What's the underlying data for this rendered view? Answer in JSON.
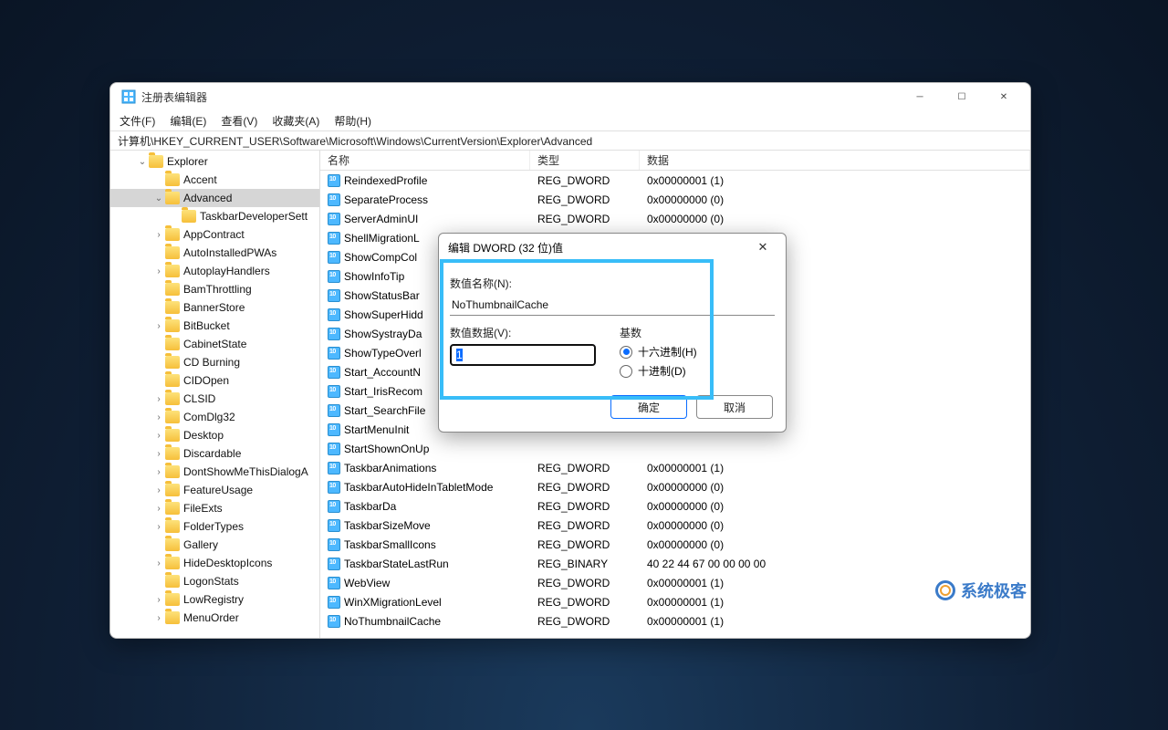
{
  "window": {
    "title": "注册表编辑器",
    "menu": [
      "文件(F)",
      "编辑(E)",
      "查看(V)",
      "收藏夹(A)",
      "帮助(H)"
    ],
    "address": "计算机\\HKEY_CURRENT_USER\\Software\\Microsoft\\Windows\\CurrentVersion\\Explorer\\Advanced"
  },
  "tree": [
    {
      "indent": 1,
      "chev": "∨",
      "label": "Explorer"
    },
    {
      "indent": 2,
      "chev": "",
      "label": "Accent"
    },
    {
      "indent": 2,
      "chev": "∨",
      "label": "Advanced",
      "selected": true
    },
    {
      "indent": 3,
      "chev": "",
      "label": "TaskbarDeveloperSett"
    },
    {
      "indent": 2,
      "chev": ">",
      "label": "AppContract"
    },
    {
      "indent": 2,
      "chev": "",
      "label": "AutoInstalledPWAs"
    },
    {
      "indent": 2,
      "chev": ">",
      "label": "AutoplayHandlers"
    },
    {
      "indent": 2,
      "chev": "",
      "label": "BamThrottling"
    },
    {
      "indent": 2,
      "chev": "",
      "label": "BannerStore"
    },
    {
      "indent": 2,
      "chev": ">",
      "label": "BitBucket"
    },
    {
      "indent": 2,
      "chev": "",
      "label": "CabinetState"
    },
    {
      "indent": 2,
      "chev": "",
      "label": "CD Burning"
    },
    {
      "indent": 2,
      "chev": "",
      "label": "CIDOpen"
    },
    {
      "indent": 2,
      "chev": ">",
      "label": "CLSID"
    },
    {
      "indent": 2,
      "chev": ">",
      "label": "ComDlg32"
    },
    {
      "indent": 2,
      "chev": ">",
      "label": "Desktop"
    },
    {
      "indent": 2,
      "chev": ">",
      "label": "Discardable"
    },
    {
      "indent": 2,
      "chev": ">",
      "label": "DontShowMeThisDialogA"
    },
    {
      "indent": 2,
      "chev": ">",
      "label": "FeatureUsage"
    },
    {
      "indent": 2,
      "chev": ">",
      "label": "FileExts"
    },
    {
      "indent": 2,
      "chev": ">",
      "label": "FolderTypes"
    },
    {
      "indent": 2,
      "chev": "",
      "label": "Gallery"
    },
    {
      "indent": 2,
      "chev": ">",
      "label": "HideDesktopIcons"
    },
    {
      "indent": 2,
      "chev": "",
      "label": "LogonStats"
    },
    {
      "indent": 2,
      "chev": ">",
      "label": "LowRegistry"
    },
    {
      "indent": 2,
      "chev": ">",
      "label": "MenuOrder"
    }
  ],
  "list": {
    "columns": [
      "名称",
      "类型",
      "数据"
    ],
    "rows": [
      {
        "name": "ReindexedProfile",
        "type": "REG_DWORD",
        "data": "0x00000001 (1)"
      },
      {
        "name": "SeparateProcess",
        "type": "REG_DWORD",
        "data": "0x00000000 (0)"
      },
      {
        "name": "ServerAdminUI",
        "type": "REG_DWORD",
        "data": "0x00000000 (0)"
      },
      {
        "name": "ShellMigrationL",
        "type": "",
        "data": ""
      },
      {
        "name": "ShowCompCol",
        "type": "",
        "data": ""
      },
      {
        "name": "ShowInfoTip",
        "type": "",
        "data": ""
      },
      {
        "name": "ShowStatusBar",
        "type": "",
        "data": ""
      },
      {
        "name": "ShowSuperHidd",
        "type": "",
        "data": ""
      },
      {
        "name": "ShowSystrayDa",
        "type": "",
        "data": ""
      },
      {
        "name": "ShowTypeOverl",
        "type": "",
        "data": ""
      },
      {
        "name": "Start_AccountN",
        "type": "",
        "data": ""
      },
      {
        "name": "Start_IrisRecom",
        "type": "",
        "data": ""
      },
      {
        "name": "Start_SearchFile",
        "type": "",
        "data": ""
      },
      {
        "name": "StartMenuInit",
        "type": "",
        "data": ""
      },
      {
        "name": "StartShownOnUp",
        "type": "",
        "data": ""
      },
      {
        "name": "TaskbarAnimations",
        "type": "REG_DWORD",
        "data": "0x00000001 (1)"
      },
      {
        "name": "TaskbarAutoHideInTabletMode",
        "type": "REG_DWORD",
        "data": "0x00000000 (0)"
      },
      {
        "name": "TaskbarDa",
        "type": "REG_DWORD",
        "data": "0x00000000 (0)"
      },
      {
        "name": "TaskbarSizeMove",
        "type": "REG_DWORD",
        "data": "0x00000000 (0)"
      },
      {
        "name": "TaskbarSmallIcons",
        "type": "REG_DWORD",
        "data": "0x00000000 (0)"
      },
      {
        "name": "TaskbarStateLastRun",
        "type": "REG_BINARY",
        "data": "40 22 44 67 00 00 00 00"
      },
      {
        "name": "WebView",
        "type": "REG_DWORD",
        "data": "0x00000001 (1)"
      },
      {
        "name": "WinXMigrationLevel",
        "type": "REG_DWORD",
        "data": "0x00000001 (1)"
      },
      {
        "name": "NoThumbnailCache",
        "type": "REG_DWORD",
        "data": "0x00000001 (1)"
      }
    ]
  },
  "dialog": {
    "title": "编辑 DWORD (32 位)值",
    "name_label": "数值名称(N):",
    "name_value": "NoThumbnailCache",
    "data_label": "数值数据(V):",
    "data_value": "1",
    "base_label": "基数",
    "radio_hex": "十六进制(H)",
    "radio_dec": "十进制(D)",
    "ok": "确定",
    "cancel": "取消"
  },
  "watermark": "系统极客"
}
